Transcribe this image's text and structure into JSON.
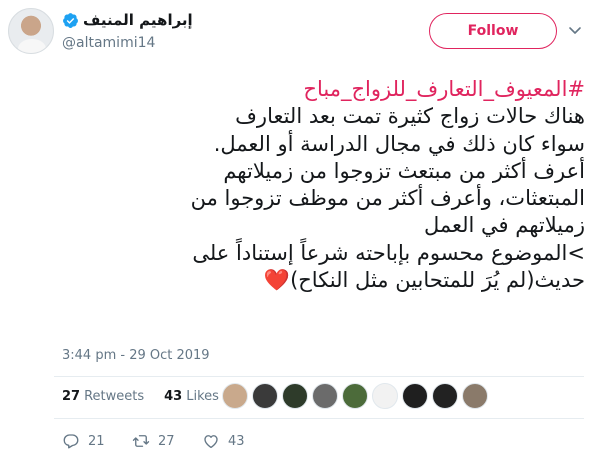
{
  "author": {
    "display_name": "إبراهيم المنيف",
    "handle": "@altamimi14",
    "verified_icon": "verified-badge-icon"
  },
  "follow_button": {
    "label": "Follow"
  },
  "tweet": {
    "hashtag": "#المعيوف_التعارف_للزواج_مباح",
    "lines": [
      "هناك حالات زواج كثيرة تمت بعد التعارف",
      "سواء كان ذلك في مجال الدراسة أو العمل.",
      "أعرف أكثر من مبتعث تزوجوا من زميلاتهم",
      "المبتعثات، وأعرف أكثر من موظف تزوجوا من",
      "زميلاتهم في العمل",
      ">الموضوع محسوم بإباحته شرعاً إستناداً على",
      "حديث(لم يُرَ للمتحابين مثل النكاح)"
    ],
    "heart": "❤️",
    "timestamp": "3:44 pm - 29 Oct 2019"
  },
  "stats": {
    "retweets_count": "27",
    "retweets_label": "Retweets",
    "likes_count": "43",
    "likes_label": "Likes"
  },
  "likers": [
    {
      "name": "liker-avatar-1",
      "color": "#c9a98c"
    },
    {
      "name": "liker-avatar-2",
      "color": "#3a3a3a"
    },
    {
      "name": "liker-avatar-3",
      "color": "#2e3b2a"
    },
    {
      "name": "liker-avatar-4",
      "color": "#6b6b6b"
    },
    {
      "name": "liker-avatar-5",
      "color": "#4c6b3a"
    },
    {
      "name": "liker-avatar-6",
      "color": "#f2f2f2"
    },
    {
      "name": "liker-avatar-7",
      "color": "#1f1f1f"
    },
    {
      "name": "liker-avatar-8",
      "color": "#222222"
    },
    {
      "name": "liker-avatar-9",
      "color": "#8a7a6a"
    }
  ],
  "actions": {
    "reply_count": "21",
    "retweet_count": "27",
    "like_count": "43"
  },
  "colors": {
    "accent": "#e0245e",
    "muted": "#657786",
    "verified": "#1da1f2",
    "separator": "#e6ecf0"
  }
}
